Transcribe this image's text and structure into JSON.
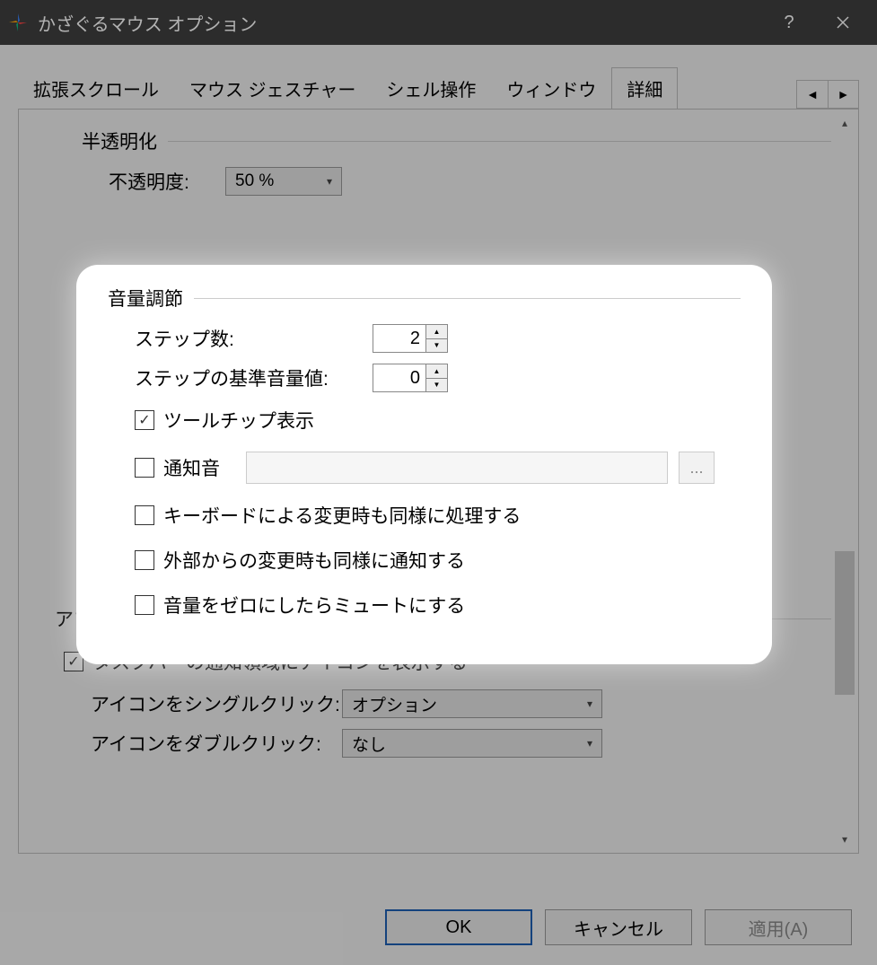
{
  "window": {
    "title": "かざぐるマウス オプション"
  },
  "tabs": {
    "items": [
      "拡張スクロール",
      "マウス ジェスチャー",
      "シェル操作",
      "ウィンドウ",
      "詳細"
    ],
    "active": "詳細"
  },
  "transparency": {
    "legend": "半透明化",
    "opacity_label": "不透明度:",
    "opacity_value": "50 %"
  },
  "volume": {
    "legend": "音量調節",
    "steps_label": "ステップ数:",
    "steps_value": "2",
    "base_label": "ステップの基準音量値:",
    "base_value": "0",
    "tooltip_label": "ツールチップ表示",
    "sound_label": "通知音",
    "browse_label": "...",
    "keyboard_label": "キーボードによる変更時も同様に処理する",
    "external_label": "外部からの変更時も同様に通知する",
    "zero_mute_label": "音量をゼロにしたらミュートにする"
  },
  "application": {
    "legend": "アプリケーション",
    "tray_label": "タスクバーの通知領域にアイコンを表示する",
    "single_click_label": "アイコンをシングルクリック:",
    "single_click_value": "オプション",
    "double_click_label": "アイコンをダブルクリック:",
    "double_click_value": "なし"
  },
  "buttons": {
    "ok": "OK",
    "cancel": "キャンセル",
    "apply": "適用(A)"
  }
}
